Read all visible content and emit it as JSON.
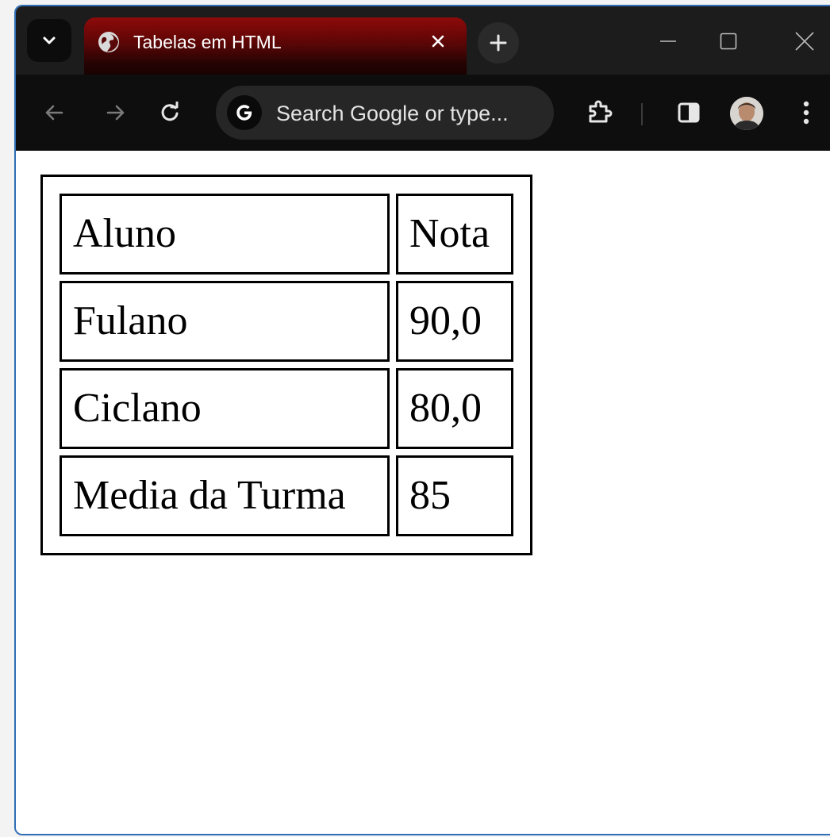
{
  "browser": {
    "tab": {
      "title": "Tabelas em HTML"
    },
    "omnibox": {
      "placeholder": "Search Google or type..."
    },
    "colors": {
      "tab_gradient_top": "#8e0a0a",
      "frame": "#1c1c1c",
      "toolbar": "#0e0e0e",
      "window_border": "#2f6db5"
    }
  },
  "page": {
    "table": {
      "header": [
        "Aluno",
        "Nota"
      ],
      "rows": [
        [
          "Fulano",
          "90,0"
        ],
        [
          "Ciclano",
          "80,0"
        ],
        [
          "Media da Turma",
          "85"
        ]
      ]
    }
  }
}
